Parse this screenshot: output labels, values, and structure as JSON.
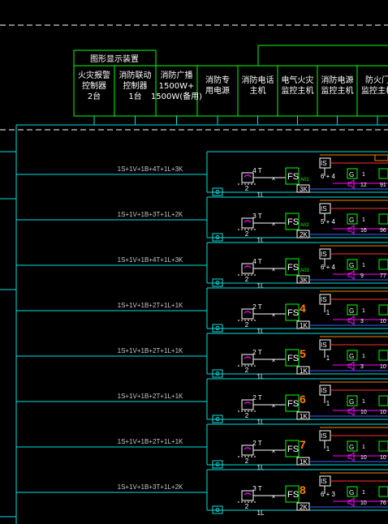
{
  "header": {
    "display_device": "图形显示装置",
    "columns": [
      {
        "lines": [
          "火灾报警",
          "控制器",
          "2台"
        ]
      },
      {
        "lines": [
          "消防联动",
          "控制器",
          "1台"
        ]
      },
      {
        "lines": [
          "消防广播",
          "1500W+",
          "1500W(备用)"
        ]
      },
      {
        "lines": [
          "消防专",
          "用电源"
        ]
      },
      {
        "lines": [
          "消防电话",
          "主机"
        ]
      },
      {
        "lines": [
          "电气火灾",
          "监控主机"
        ]
      },
      {
        "lines": [
          "消防电源",
          "监控主机"
        ]
      },
      {
        "lines": [
          "防火门",
          "监控主机"
        ]
      }
    ]
  },
  "rows": [
    {
      "cable": "1S+1V+1B+4T+1L+3K",
      "t": "4 T",
      "l": "1L",
      "addr": "A01",
      "addr_big": false,
      "k": "3K",
      "counts": "6 + 4",
      "g": "1",
      "spk": "12",
      "last": "91"
    },
    {
      "cable": "1S+1V+1B+3T+1L+2K",
      "t": "3 T",
      "l": "1L",
      "addr": "A02",
      "addr_big": false,
      "k": "2K",
      "counts": "5 + 4",
      "g": "1",
      "spk": "16",
      "last": "96"
    },
    {
      "cable": "1S+1V+1B+4T+1L+3K",
      "t": "4 T",
      "l": "1L",
      "addr": "A03",
      "addr_big": false,
      "k": "3K",
      "counts": "6 + 4",
      "g": "1",
      "spk": "9",
      "last": "77"
    },
    {
      "cable": "1S+1V+1B+2T+1L+1K",
      "t": "2 T",
      "l": "1L",
      "addr": "4",
      "addr_big": true,
      "k": "1K",
      "counts": "1",
      "g": "1",
      "spk": "3",
      "last": "10"
    },
    {
      "cable": "1S+1V+1B+2T+1L+1K",
      "t": "2 T",
      "l": "1L",
      "addr": "5",
      "addr_big": true,
      "k": "1K",
      "counts": "1",
      "g": "1",
      "spk": "3",
      "last": "10"
    },
    {
      "cable": "1S+1V+1B+2T+1L+1K",
      "t": "2 T",
      "l": "1L",
      "addr": "6",
      "addr_big": true,
      "k": "1K",
      "counts": "1",
      "g": "1",
      "spk": "10",
      "last": "10"
    },
    {
      "cable": "1S+1V+1B+2T+1L+1K",
      "t": "2 T",
      "l": "1L",
      "addr": "7",
      "addr_big": true,
      "k": "1K",
      "counts": "1",
      "g": "1",
      "spk": "10",
      "last": "10"
    },
    {
      "cable": "1S+1V+1B+3T+1L+2K",
      "t": "3 T",
      "l": "1L",
      "addr": "8",
      "addr_big": true,
      "k": "2K",
      "counts": "6 + 3",
      "g": "1",
      "spk": "10",
      "last": "76"
    }
  ],
  "labels": {
    "fs": "FS",
    "is": "IS",
    "g": "G"
  }
}
